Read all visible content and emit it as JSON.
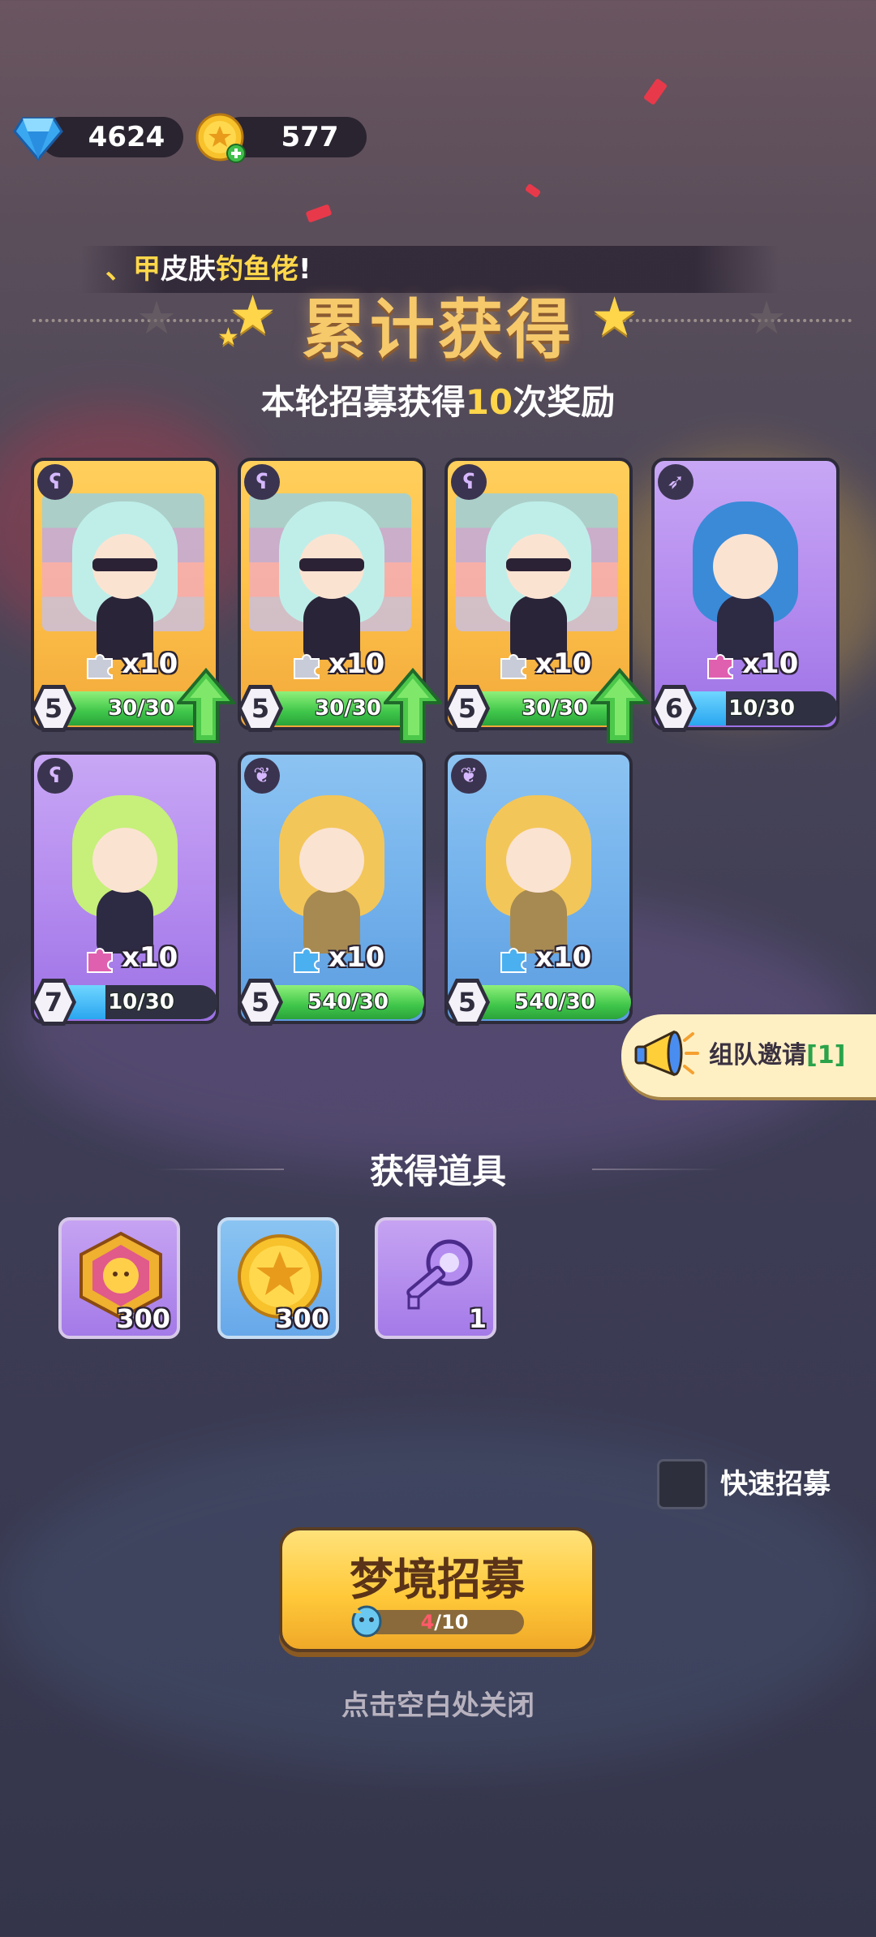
{
  "currency": {
    "gems": "4624",
    "coins": "577"
  },
  "ticker": {
    "prefix": "、甲",
    "middle": "皮肤",
    "highlight": "钓鱼佬",
    "suffix": "!"
  },
  "header": {
    "title": "累计获得",
    "subtitle_pre": "本轮招募获得",
    "subtitle_num": "10",
    "subtitle_post": "次奖励"
  },
  "cards": [
    {
      "theme": "gold",
      "shards": "x10",
      "level": "5",
      "progress": "30/30",
      "fill": 1.0,
      "bar": "green",
      "upgrade": true,
      "class_icon": "staff-icon"
    },
    {
      "theme": "gold",
      "shards": "x10",
      "level": "5",
      "progress": "30/30",
      "fill": 1.0,
      "bar": "green",
      "upgrade": true,
      "class_icon": "staff-icon"
    },
    {
      "theme": "gold",
      "shards": "x10",
      "level": "5",
      "progress": "30/30",
      "fill": 1.0,
      "bar": "green",
      "upgrade": true,
      "class_icon": "staff-icon"
    },
    {
      "theme": "purple",
      "shards": "x10",
      "level": "6",
      "progress": "10/30",
      "fill": 0.33,
      "bar": "blue",
      "upgrade": false,
      "class_icon": "bow-icon"
    },
    {
      "theme": "purple",
      "shards": "x10",
      "level": "7",
      "progress": "10/30",
      "fill": 0.33,
      "bar": "blue",
      "upgrade": false,
      "class_icon": "staff-icon"
    },
    {
      "theme": "blue",
      "shards": "x10",
      "level": "5",
      "progress": "540/30",
      "fill": 1.0,
      "bar": "green",
      "upgrade": false,
      "class_icon": "wings-icon"
    },
    {
      "theme": "blue",
      "shards": "x10",
      "level": "5",
      "progress": "540/30",
      "fill": 1.0,
      "bar": "green",
      "upgrade": false,
      "class_icon": "wings-icon"
    }
  ],
  "invite": {
    "label": "组队邀请",
    "count": "[1]"
  },
  "items_section": {
    "title": "获得道具",
    "items": [
      {
        "name": "hero-medal",
        "icon": "medal-icon",
        "qty": "300",
        "theme": "purple"
      },
      {
        "name": "star-coin",
        "icon": "coin-icon",
        "qty": "300",
        "theme": "blue"
      },
      {
        "name": "key",
        "icon": "key-icon",
        "qty": "1",
        "theme": "purple"
      }
    ]
  },
  "quick": {
    "label": "快速招募"
  },
  "recruit_button": {
    "label": "梦境招募",
    "progress_current": "4",
    "progress_total": "/10"
  },
  "hint": "点击空白处关闭",
  "colors": {
    "gold_text": "#ffd54a",
    "green_bar": "#3fc64a",
    "blue_bar": "#2aa6f0"
  }
}
